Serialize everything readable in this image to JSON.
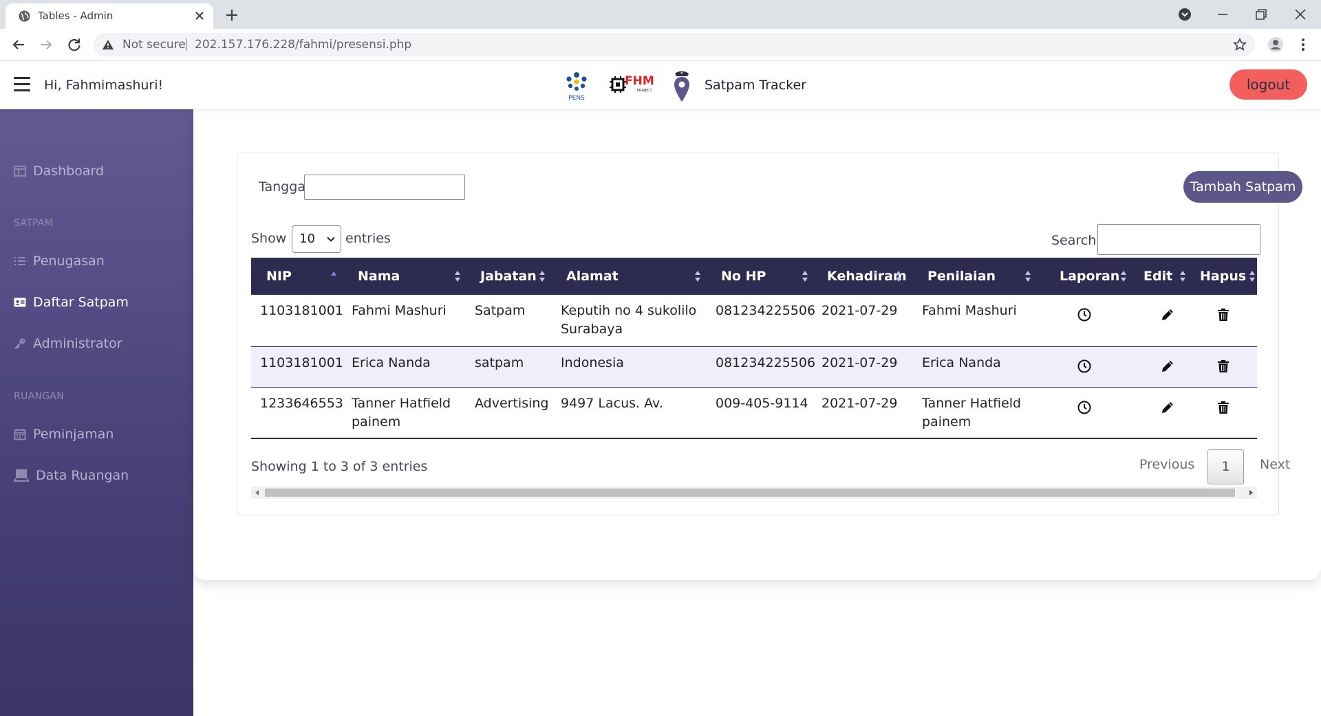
{
  "browser": {
    "tab_title": "Tables - Admin",
    "address_security": "Not secure",
    "address_url": "202.157.176.228/fahmi/presensi.php"
  },
  "header": {
    "greeting": "Hi, Fahmimashuri!",
    "brand": "Satpam Tracker",
    "logo_pens_text": "PENS",
    "logo_fhm_text": "FHM",
    "logo_fhm_sub": "PROJECT",
    "logout_label": "logout"
  },
  "sidebar": {
    "items": [
      {
        "label": "Dashboard",
        "icon": "dashboard-icon"
      },
      {
        "label": "Penugasan",
        "icon": "list-icon"
      },
      {
        "label": "Daftar Satpam",
        "icon": "id-card-icon"
      },
      {
        "label": "Administrator",
        "icon": "key-icon"
      },
      {
        "label": "Peminjaman",
        "icon": "calendar-icon"
      },
      {
        "label": "Data Ruangan",
        "icon": "room-icon"
      }
    ],
    "headings": [
      "SATPAM",
      "RUANGAN"
    ],
    "active": "Daftar Satpam"
  },
  "filters": {
    "tanggal_label": "Tanggal:",
    "tanggal_value": "",
    "tambah_label": "Tambah Satpam",
    "show_label": "Show",
    "show_value": "10",
    "entries_label": "entries",
    "search_label": "Search:",
    "search_value": ""
  },
  "table": {
    "columns": [
      "NIP",
      "Nama",
      "Jabatan",
      "Alamat",
      "No HP",
      "Kehadiram",
      "Penilaian",
      "Laporan",
      "Edit",
      "Hapus"
    ],
    "rows": [
      {
        "nip": "1103181001",
        "nama": "Fahmi Mashuri",
        "jabatan": "Satpam",
        "alamat": "Keputih no 4 sukolilo Surabaya",
        "nohp": "081234225506",
        "kehadiran": "2021-07-29",
        "penilaian": "Fahmi Mashuri"
      },
      {
        "nip": "1103181001",
        "nama": "Erica Nanda",
        "jabatan": "satpam",
        "alamat": "Indonesia",
        "nohp": "081234225506",
        "kehadiran": "2021-07-29",
        "penilaian": "Erica Nanda"
      },
      {
        "nip": "1233646553",
        "nama": "Tanner Hatfield painem",
        "jabatan": "Advertising",
        "alamat": "9497 Lacus. Av.",
        "nohp": "009-405-9114",
        "kehadiran": "2021-07-29",
        "penilaian": "Tanner Hatfield painem"
      }
    ]
  },
  "pagination": {
    "info": "Showing 1 to 3 of 3 entries",
    "previous": "Previous",
    "current": "1",
    "next": "Next"
  },
  "colors": {
    "sidebar_top": "#625a93",
    "sidebar_bottom": "#3b3464",
    "table_header": "#2d2b4f",
    "logout": "#f25f5c",
    "tambah": "#5c5788",
    "row_alt": "#f0eefb"
  }
}
